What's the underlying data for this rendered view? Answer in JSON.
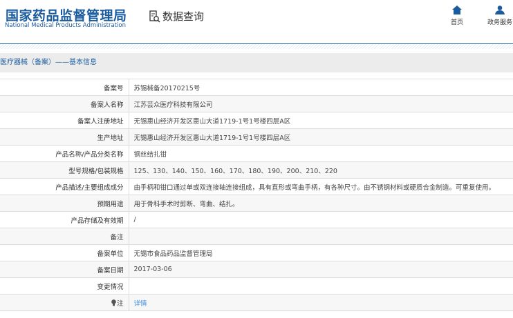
{
  "header": {
    "logo_cn": "国家药品监督管理局",
    "logo_en": "National Medical Products Administration",
    "section": "数据查询",
    "nav": [
      {
        "label": "首页",
        "icon": "home-icon"
      },
      {
        "label": "政务服务",
        "icon": "user-icon"
      }
    ]
  },
  "breadcrumb": "医疗器械（备案）——基本信息",
  "rows": [
    {
      "label": "备案号",
      "value": "苏锡械备20170215号"
    },
    {
      "label": "备案人名称",
      "value": "江苏芸众医疗科技有限公司"
    },
    {
      "label": "备案人注册地址",
      "value": "无锡惠山经济开发区惠山大道1719-1号1号楼四层A区"
    },
    {
      "label": "生产地址",
      "value": "无锡惠山经济开发区惠山大道1719-1号1号楼四层A区"
    },
    {
      "label": "产品名称/产品分类名称",
      "value": "钢丝结扎钳"
    },
    {
      "label": "型号规格/包装规格",
      "value": "125、130、140、150、160、170、180、190、200、210、220"
    },
    {
      "label": "产品描述/主要组成成分",
      "value": "由手柄和钳口通过单或双连接轴连接组成，具有直形或弯曲手柄，有各种尺寸。由不锈钢材料或硬质合金制造。可重复使用。"
    },
    {
      "label": "预期用途",
      "value": "用于骨科手术时剪断、弯曲、结扎。"
    },
    {
      "label": "产品存储及有效期",
      "value": "/"
    },
    {
      "label": "备注",
      "value": ""
    },
    {
      "label": "备案单位",
      "value": "无锡市食品药品监督管理局"
    },
    {
      "label": "备案日期",
      "value": "2017-03-06"
    },
    {
      "label": "变更情况",
      "value": ""
    },
    {
      "label": "注",
      "value": "详情"
    }
  ]
}
